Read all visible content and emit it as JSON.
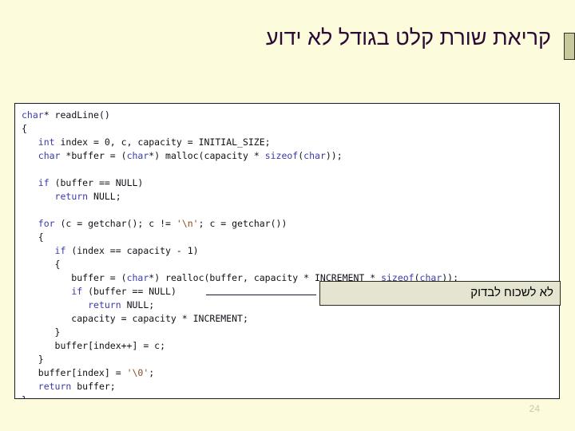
{
  "slide": {
    "background_color": "#FCFCDC",
    "title": "קריאת שורת קלט בגודל לא ידוע",
    "title_color": "#2B0A33",
    "marker_color": "#C8C89A",
    "slide_number": "24"
  },
  "code_block": {
    "language": "c",
    "background_color": "#FFFFFF",
    "border_color": "#1A1A2E",
    "keyword_color": "#3B3BA8",
    "string_color": "#8C4A20",
    "text_color": "#101018",
    "lines": [
      "char* readLine()",
      "{",
      "   int index = 0, c, capacity = INITIAL_SIZE;",
      "   char *buffer = (char*) malloc(capacity * sizeof(char));",
      "",
      "   if (buffer == NULL)",
      "      return NULL;",
      "",
      "   for (c = getchar(); c != '\\n'; c = getchar())",
      "   {",
      "      if (index == capacity - 1)",
      "      {",
      "         buffer = (char*) realloc(buffer, capacity * INCREMENT * sizeof(char));",
      "         if (buffer == NULL)",
      "            return NULL;",
      "         capacity = capacity * INCREMENT;",
      "      }",
      "      buffer[index++] = c;",
      "   }",
      "   buffer[index] = '\\0';",
      "   return buffer;",
      "}"
    ],
    "keywords": [
      "char",
      "int",
      "return",
      "if",
      "for",
      "sizeof"
    ],
    "string_literals": [
      "'\\n'",
      "'\\0'"
    ],
    "identifiers": [
      "readLine",
      "index",
      "c",
      "capacity",
      "INITIAL_SIZE",
      "buffer",
      "malloc",
      "NULL",
      "getchar",
      "realloc",
      "INCREMENT"
    ]
  },
  "annotation": {
    "note_text": "לא לשכוח לבדוק",
    "note_background": "#E4E4D0",
    "note_border": "#2A2A20",
    "leader_line_color": "#1A1A2E"
  }
}
